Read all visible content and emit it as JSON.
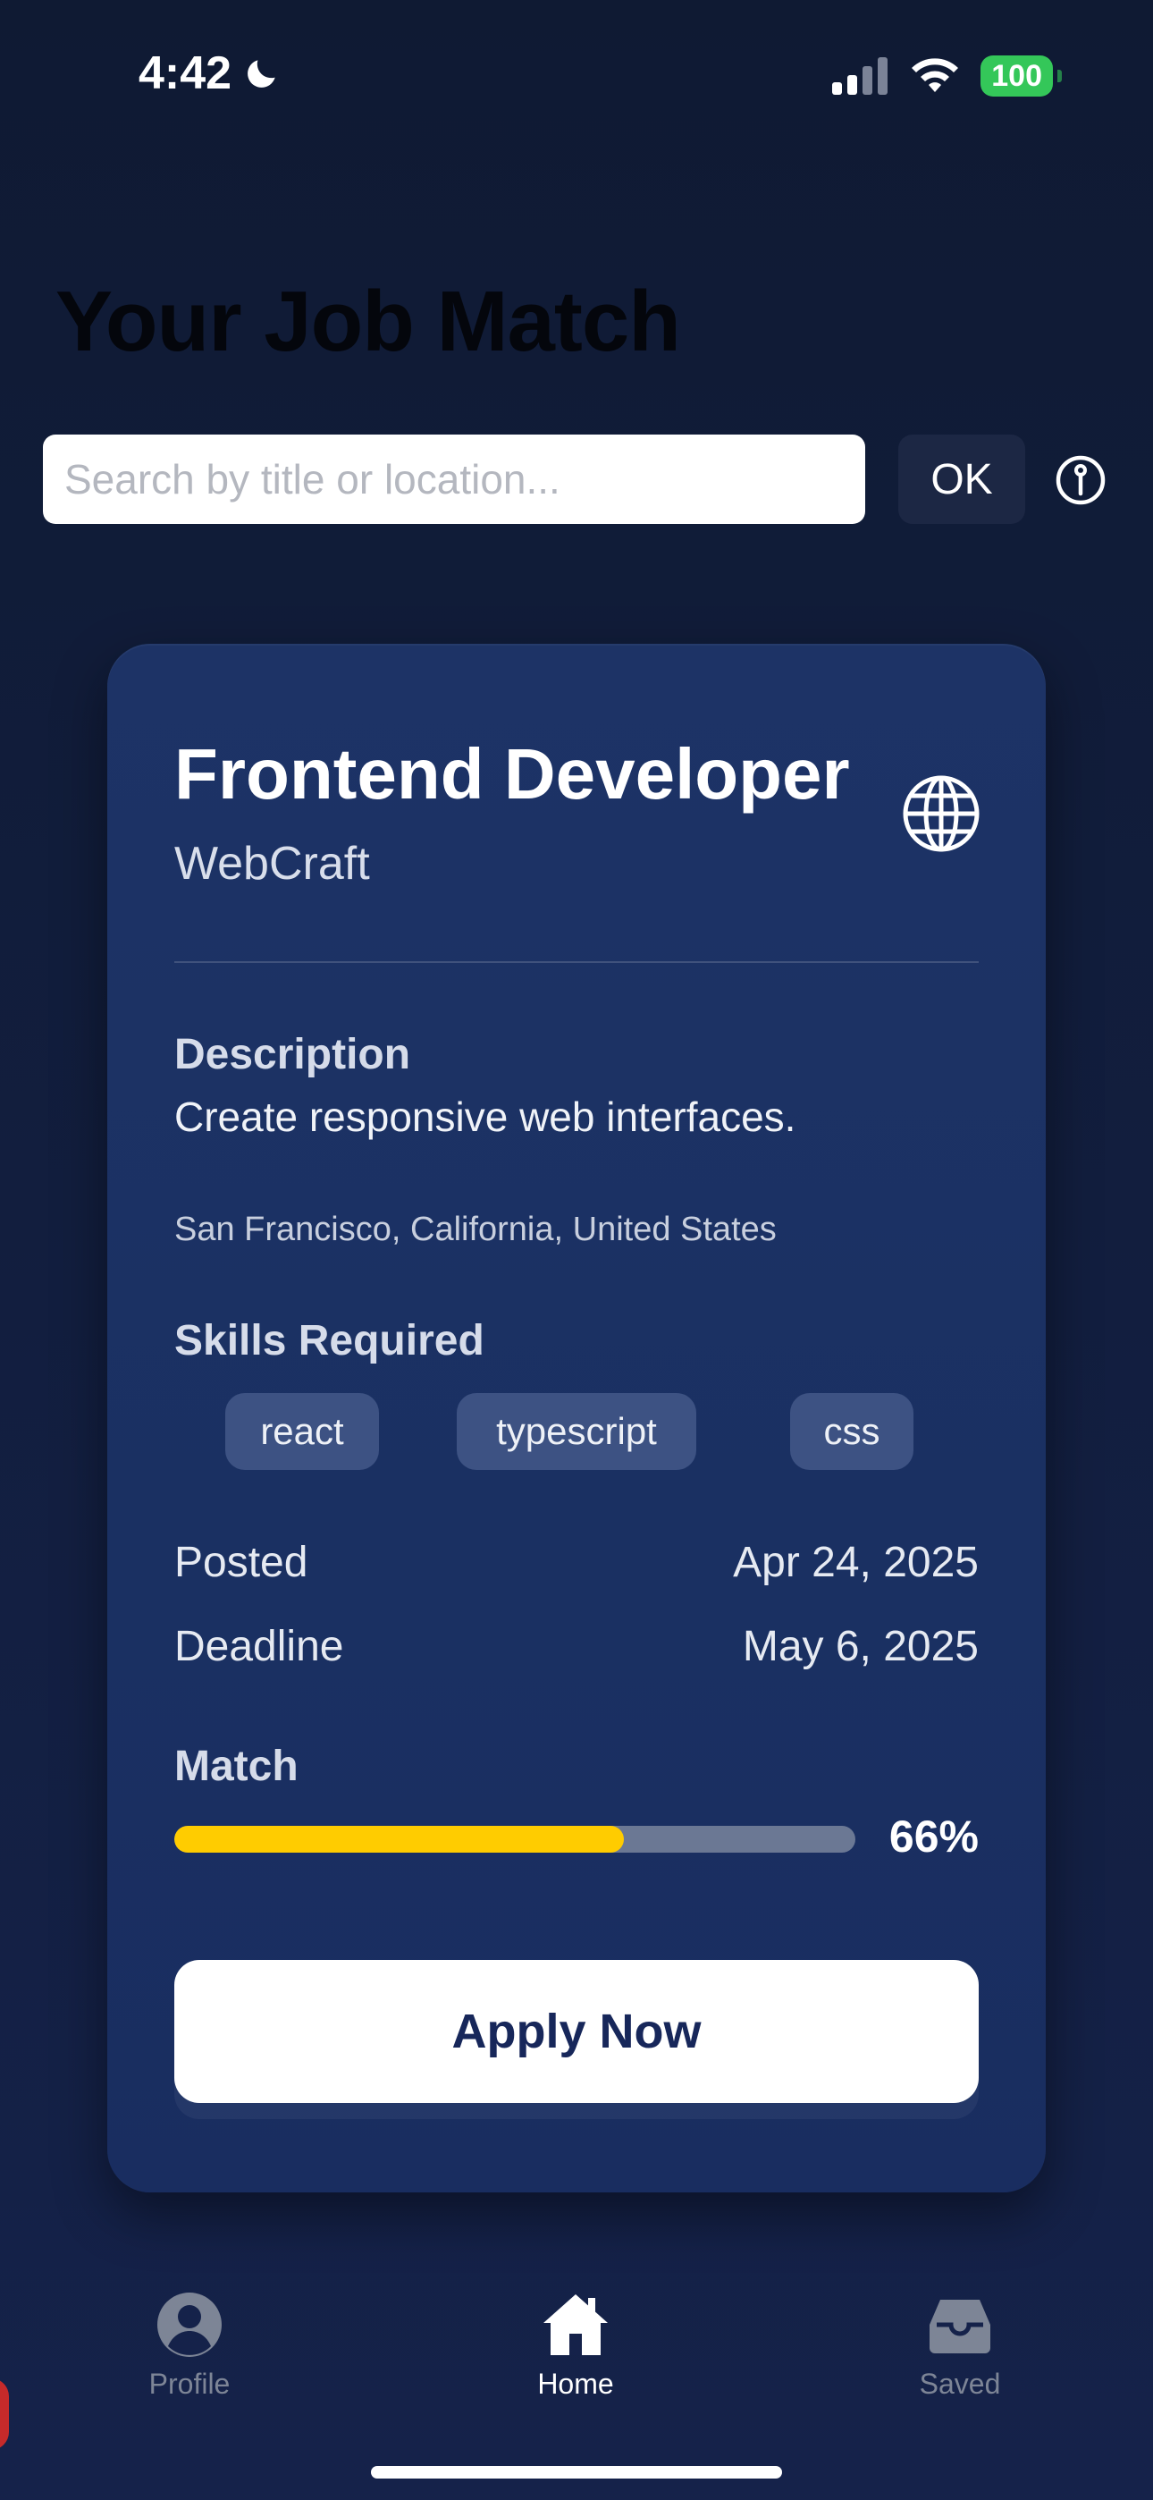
{
  "status_bar": {
    "time": "4:42",
    "battery": "100"
  },
  "header": {
    "title": "Your Job Match"
  },
  "search": {
    "placeholder": "Search by title or location...",
    "ok_label": "OK"
  },
  "job": {
    "title": "Frontend Developer",
    "company": "WebCraft",
    "description_label": "Description",
    "description": "Create responsive web interfaces.",
    "location": "San Francisco, California, United States",
    "skills_label": "Skills Required",
    "skills": [
      "react",
      "typescript",
      "css"
    ],
    "posted_label": "Posted",
    "posted_value": "Apr 24, 2025",
    "deadline_label": "Deadline",
    "deadline_value": "May 6, 2025",
    "match_label": "Match",
    "match_percent": 66,
    "match_text": "66%",
    "apply_label": "Apply Now"
  },
  "nav": {
    "tabs": [
      {
        "label": "Profile",
        "icon": "person-circle-icon",
        "active": false
      },
      {
        "label": "Home",
        "icon": "house-icon",
        "active": true
      },
      {
        "label": "Saved",
        "icon": "tray-icon",
        "active": false
      }
    ]
  },
  "colors": {
    "accent": "#ffcc00",
    "card": "#1c3265",
    "battery": "#34c759"
  }
}
